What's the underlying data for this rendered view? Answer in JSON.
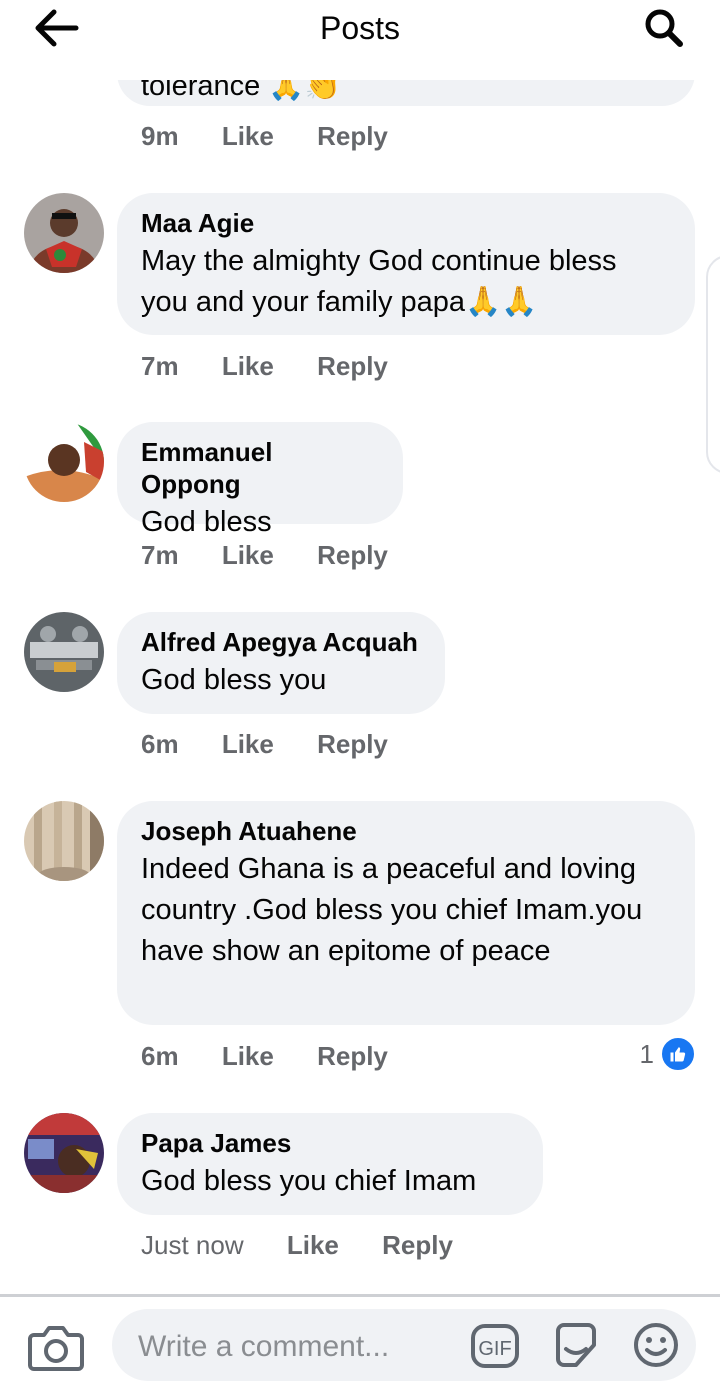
{
  "header": {
    "title": "Posts"
  },
  "partial_comment": {
    "text": "tolerance 🙏👏",
    "time": "9m",
    "like_label": "Like",
    "reply_label": "Reply"
  },
  "comments": [
    {
      "name": "Maa Agie",
      "text": "May the almighty God continue bless you and your family  papa🙏🙏",
      "time": "7m",
      "like_label": "Like",
      "reply_label": "Reply"
    },
    {
      "name": "Emmanuel Oppong",
      "text": "God bless",
      "time": "7m",
      "like_label": "Like",
      "reply_label": "Reply"
    },
    {
      "name": "Alfred Apegya Acquah",
      "text": "God bless you",
      "time": "6m",
      "like_label": "Like",
      "reply_label": "Reply"
    },
    {
      "name": "Joseph Atuahene",
      "text": "Indeed Ghana is a peaceful and loving country .God bless you chief Imam.you have show an epitome of peace",
      "time": "6m",
      "like_label": "Like",
      "reply_label": "Reply",
      "reaction_count": "1"
    },
    {
      "name": "Papa James",
      "text": "God bless you chief Imam",
      "time": "Just now",
      "like_label": "Like",
      "reply_label": "Reply"
    }
  ],
  "composer": {
    "placeholder": "Write a comment..."
  },
  "colors": {
    "bubble": "#f0f2f5",
    "meta": "#65676b",
    "accent": "#1877f2"
  },
  "icons": [
    "back-arrow-icon",
    "search-icon",
    "like-thumb-icon",
    "camera-icon",
    "gif-icon",
    "sticker-icon",
    "emoji-icon"
  ]
}
